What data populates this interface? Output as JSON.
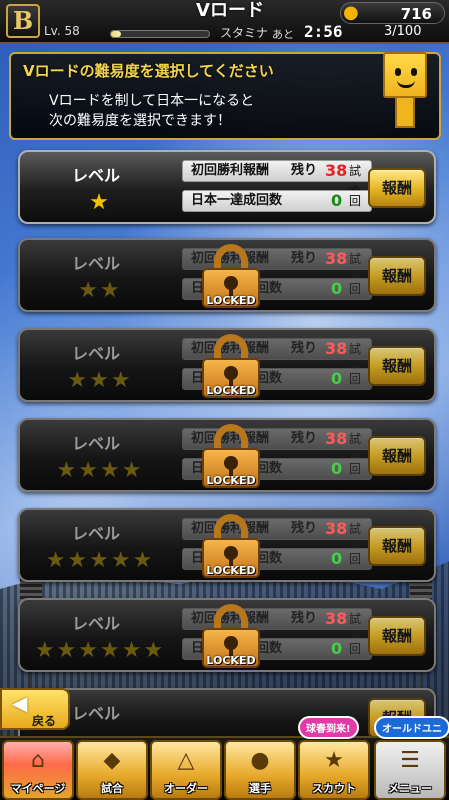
{
  "header": {
    "title": "Vロード",
    "team_logo": "B",
    "coins": "716",
    "level_label": "Lv. 58",
    "stamina_label": "スタミナ",
    "ato_label": "あと",
    "timer": "2:56",
    "stamina_value": "3/100",
    "level_progress_percent": 10
  },
  "info": {
    "title": "Vロードの難易度を選択してください",
    "line1": "Vロードを制して日本一になると",
    "line2": "次の難易度を選択できます！"
  },
  "rows": [
    {
      "label": "レベル",
      "stars": "★",
      "first_win": "初回勝利報酬",
      "remain": "残り",
      "remain_num": "38",
      "unit1": "試合",
      "achieve": "日本一達成回数",
      "achieve_num": "0",
      "unit2": "回",
      "reward": "報酬",
      "locked": false
    },
    {
      "label": "レベル",
      "stars": "★★",
      "first_win": "初回勝利報酬",
      "remain": "残り",
      "remain_num": "38",
      "unit1": "試合",
      "achieve": "日本一達成回数",
      "achieve_num": "0",
      "unit2": "回",
      "reward": "報酬",
      "locked": true,
      "lock_text": "LOCKED"
    },
    {
      "label": "レベル",
      "stars": "★★★",
      "first_win": "初回勝利報酬",
      "remain": "残り",
      "remain_num": "38",
      "unit1": "試合",
      "achieve": "日本一達成回数",
      "achieve_num": "0",
      "unit2": "回",
      "reward": "報酬",
      "locked": true,
      "lock_text": "LOCKED"
    },
    {
      "label": "レベル",
      "stars": "★★★★",
      "first_win": "初回勝利報酬",
      "remain": "残り",
      "remain_num": "38",
      "unit1": "試合",
      "achieve": "日本一達成回数",
      "achieve_num": "0",
      "unit2": "回",
      "reward": "報酬",
      "locked": true,
      "lock_text": "LOCKED"
    },
    {
      "label": "レベル",
      "stars": "★★★★★",
      "first_win": "初回勝利報酬",
      "remain": "残り",
      "remain_num": "38",
      "unit1": "試合",
      "achieve": "日本一達成回数",
      "achieve_num": "0",
      "unit2": "回",
      "reward": "報酬",
      "locked": true,
      "lock_text": "LOCKED"
    },
    {
      "label": "レベル",
      "stars": "★★★★★★",
      "first_win": "初回勝利報酬",
      "remain": "残り",
      "remain_num": "38",
      "unit1": "試合",
      "achieve": "日本一達成回数",
      "achieve_num": "0",
      "unit2": "回",
      "reward": "報酬",
      "locked": true,
      "lock_text": "LOCKED"
    },
    {
      "label": "レベル",
      "stars": "",
      "first_win": "",
      "remain": "",
      "remain_num": "",
      "unit1": "",
      "achieve": "",
      "achieve_num": "",
      "unit2": "",
      "reward": "報酬",
      "locked": true
    }
  ],
  "back": {
    "label": "戻る"
  },
  "nav": [
    {
      "label": "マイページ",
      "icon": "house-icon"
    },
    {
      "label": "試合",
      "icon": "baseball-diamond-icon"
    },
    {
      "label": "オーダー",
      "icon": "field-icon"
    },
    {
      "label": "選手",
      "icon": "player-icon"
    },
    {
      "label": "スカウト",
      "icon": "scout-icon",
      "badge": "球春到来!"
    },
    {
      "label": "メニュー",
      "icon": "menu-icon",
      "badge": "オールドユニ"
    }
  ]
}
